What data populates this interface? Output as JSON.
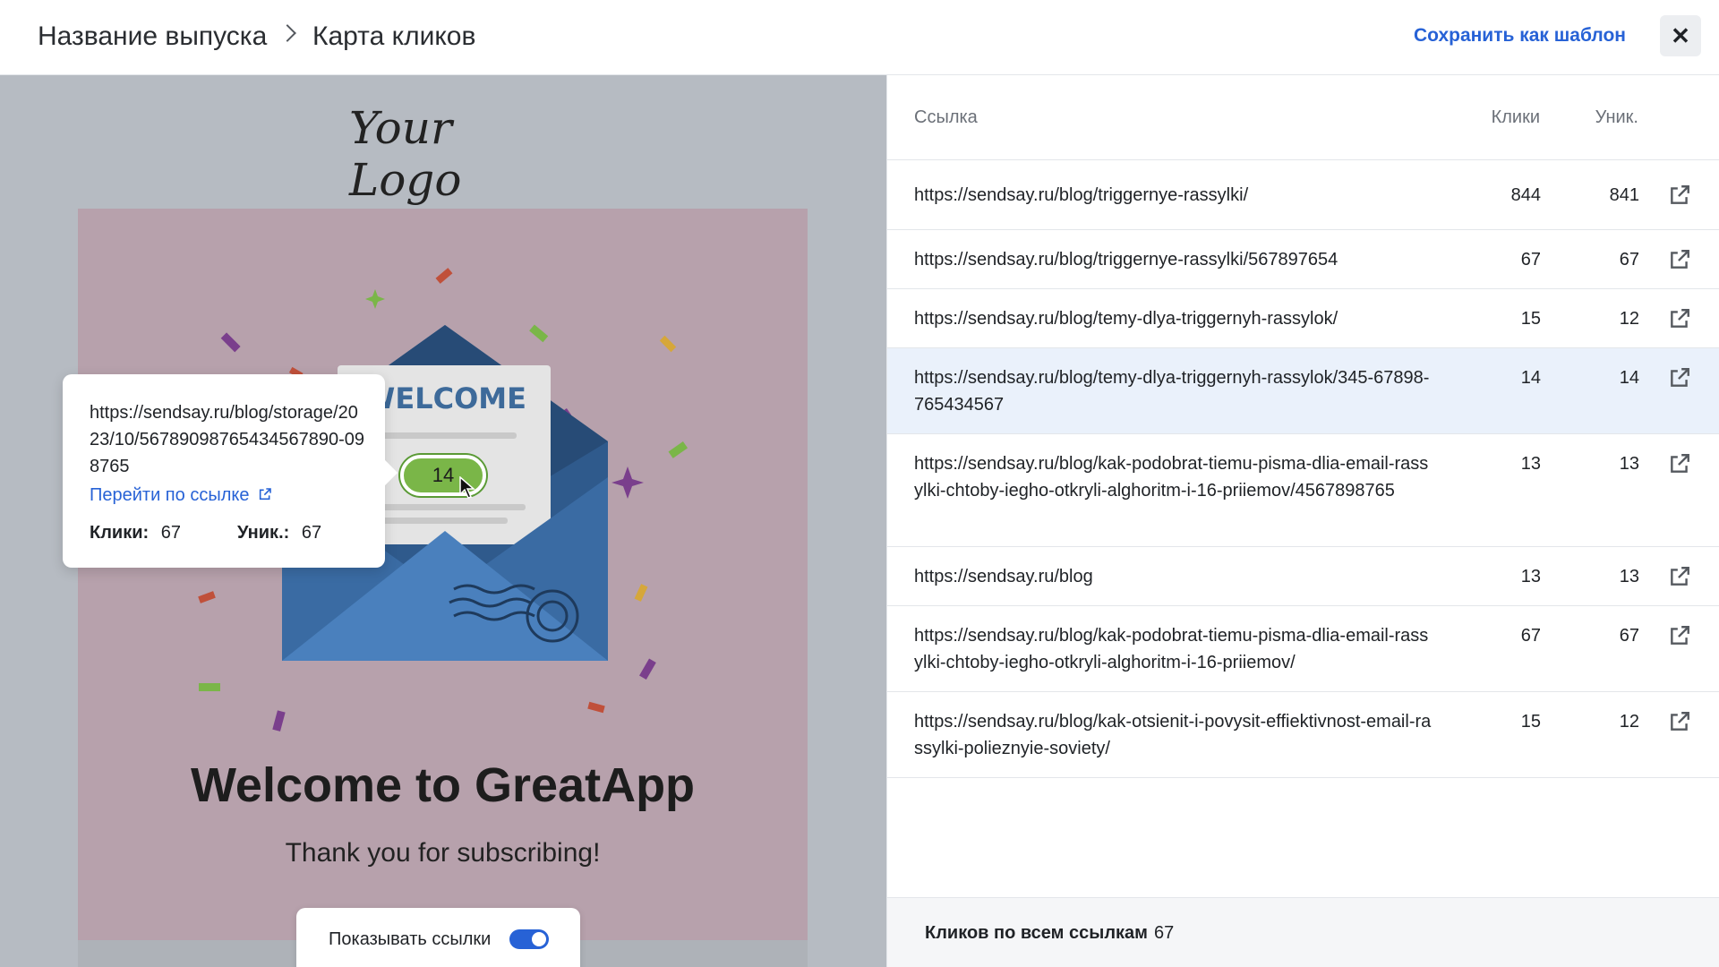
{
  "header": {
    "breadcrumb_parent": "Название выпуска",
    "breadcrumb_current": "Карта кликов",
    "save_template_label": "Сохранить как шаблон",
    "close_symbol": "✕"
  },
  "preview": {
    "logo_text": "Your Logo",
    "hero_banner_text": "WELCOME",
    "welcome_title": "Welcome to GreatApp",
    "welcome_subtitle": "Thank you for subscribing!",
    "click_badge_value": "14",
    "show_links_label": "Показывать ссылки",
    "show_links_enabled": true,
    "tooltip": {
      "url": "https://sendsay.ru/blog/storage/2023/10/56789098765434567890-098765",
      "go_to_link_label": "Перейти по ссылке",
      "clicks_label": "Клики:",
      "clicks_value": "67",
      "unique_label": "Уник.:",
      "unique_value": "67"
    }
  },
  "table": {
    "columns": {
      "link": "Ссылка",
      "clicks": "Клики",
      "unique": "Уник."
    },
    "rows": [
      {
        "url": "https://sendsay.ru/blog/triggernye-rassylki/",
        "clicks": "844",
        "unique": "841",
        "highlighted": false
      },
      {
        "url": "https://sendsay.ru/blog/triggernye-rassylki/567897654",
        "clicks": "67",
        "unique": "67",
        "highlighted": false
      },
      {
        "url": "https://sendsay.ru/blog/temy-dlya-triggernyh-rassylok/",
        "clicks": "15",
        "unique": "12",
        "highlighted": false
      },
      {
        "url": "https://sendsay.ru/blog/temy-dlya-triggernyh-rassylok/345-67898-765434567",
        "clicks": "14",
        "unique": "14",
        "highlighted": true
      },
      {
        "url": "https://sendsay.ru/blog/kak-podobrat-tiemu-pisma-dlia-email-rassylki-chtoby-iegho-otkryli-alghoritm-i-16-priiemov/4567898765",
        "clicks": "13",
        "unique": "13",
        "highlighted": false
      },
      {
        "url": "https://sendsay.ru/blog",
        "clicks": "13",
        "unique": "13",
        "highlighted": false
      },
      {
        "url": "https://sendsay.ru/blog/kak-podobrat-tiemu-pisma-dlia-email-rassylki-chtoby-iegho-otkryli-alghoritm-i-16-priiemov/",
        "clicks": "67",
        "unique": "67",
        "highlighted": false
      },
      {
        "url": "https://sendsay.ru/blog/kak-otsienit-i-povysit-effiektivnost-email-rassylki-polieznyie-soviety/",
        "clicks": "15",
        "unique": "12",
        "highlighted": false
      }
    ],
    "footer_label": "Кликов по всем ссылкам",
    "footer_value": "67"
  },
  "colors": {
    "accent": "#2762d6",
    "highlight_row": "#eaf1fb",
    "email_bg": "#b7a1ac",
    "preview_bg": "#b6bbc2",
    "badge": "#7ab648"
  },
  "icons": [
    "chevron-right-icon",
    "close-icon",
    "external-link-icon",
    "cursor-icon"
  ]
}
